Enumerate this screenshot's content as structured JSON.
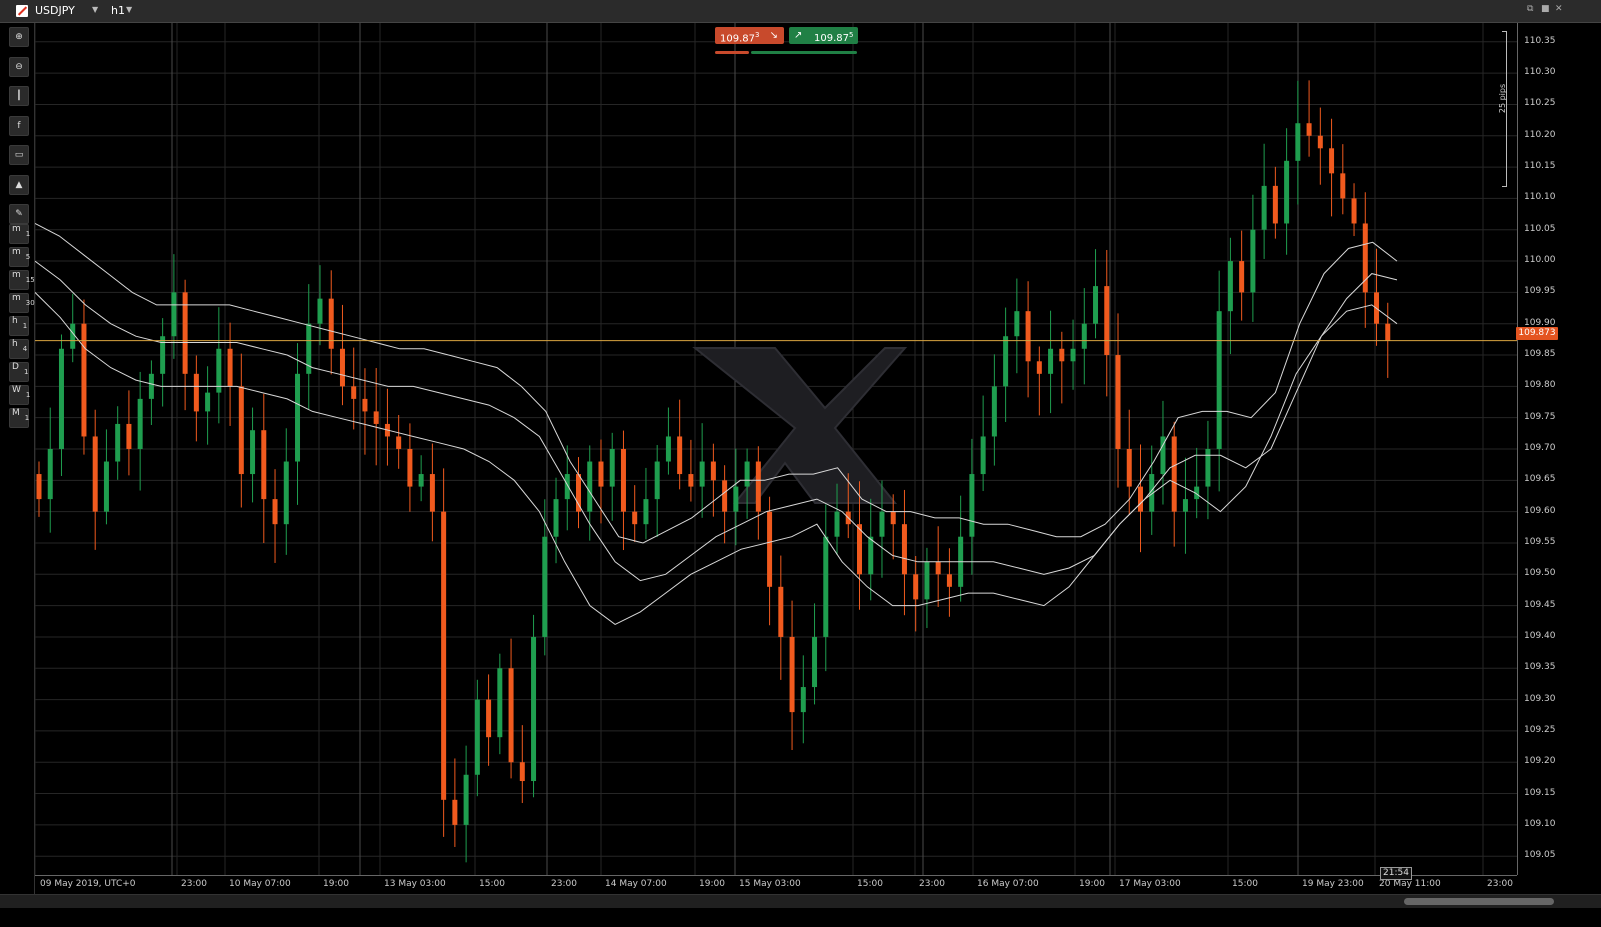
{
  "toolbar": {
    "symbol": "USDJPY",
    "timeframe": "h1"
  },
  "quote": {
    "sell_price": "109.87",
    "sell_sup": "3",
    "buy_price": "109.87",
    "buy_sup": "5",
    "sell_color": "#c84a2c",
    "buy_color": "#208045"
  },
  "sidebar": {
    "icons": [
      "zoom-in-icon",
      "zoom-out-icon",
      "candles-icon",
      "fb-share-icon",
      "link-icon",
      "chart-style-icon",
      "indicators-icon"
    ],
    "timeframes": [
      {
        "main": "m",
        "sub": "1"
      },
      {
        "main": "m",
        "sub": "5"
      },
      {
        "main": "m",
        "sub": "15"
      },
      {
        "main": "m",
        "sub": "30"
      },
      {
        "main": "h",
        "sub": "1"
      },
      {
        "main": "h",
        "sub": "4"
      },
      {
        "main": "D",
        "sub": "1"
      },
      {
        "main": "W",
        "sub": "1"
      },
      {
        "main": "M",
        "sub": "1"
      }
    ]
  },
  "pips_label": "25 pips",
  "current_price": "109.873",
  "current_time": "21:54",
  "colors": {
    "bull": "#1f9e4f",
    "bear": "#f05a1e",
    "price_line": "#d9a441",
    "band": "#d8d8d8"
  },
  "chart_data": {
    "type": "candlestick",
    "symbol": "USDJPY",
    "timeframe": "h1",
    "ylim": [
      109.02,
      110.38
    ],
    "price_ticks": [
      "110.35",
      "110.30",
      "110.25",
      "110.20",
      "110.15",
      "110.10",
      "110.05",
      "110.00",
      "109.95",
      "109.90",
      "109.85",
      "109.80",
      "109.75",
      "109.70",
      "109.65",
      "109.60",
      "109.55",
      "109.50",
      "109.45",
      "109.40",
      "109.35",
      "109.30",
      "109.25",
      "109.20",
      "109.15",
      "109.10",
      "109.05"
    ],
    "time_labels": [
      "09 May 2019, UTC+0",
      "23:00",
      "10 May 07:00",
      "19:00",
      "13 May 03:00",
      "15:00",
      "23:00",
      "14 May 07:00",
      "19:00",
      "15 May 03:00",
      "15:00",
      "23:00",
      "16 May 07:00",
      "19:00",
      "17 May 03:00",
      "15:00",
      "19 May 23:00",
      "20 May 11:00",
      "23:00"
    ],
    "current_price": 109.873,
    "closes": [
      109.62,
      109.7,
      109.86,
      109.9,
      109.72,
      109.6,
      109.68,
      109.74,
      109.7,
      109.78,
      109.82,
      109.88,
      109.95,
      109.82,
      109.76,
      109.79,
      109.86,
      109.8,
      109.66,
      109.73,
      109.62,
      109.58,
      109.68,
      109.82,
      109.9,
      109.94,
      109.86,
      109.8,
      109.78,
      109.76,
      109.74,
      109.72,
      109.7,
      109.64,
      109.66,
      109.6,
      109.14,
      109.1,
      109.18,
      109.3,
      109.24,
      109.35,
      109.2,
      109.17,
      109.4,
      109.56,
      109.62,
      109.66,
      109.6,
      109.68,
      109.64,
      109.7,
      109.6,
      109.58,
      109.62,
      109.68,
      109.72,
      109.66,
      109.64,
      109.68,
      109.65,
      109.6,
      109.64,
      109.68,
      109.6,
      109.48,
      109.4,
      109.28,
      109.32,
      109.4,
      109.56,
      109.6,
      109.58,
      109.5,
      109.56,
      109.6,
      109.58,
      109.5,
      109.46,
      109.52,
      109.5,
      109.48,
      109.56,
      109.66,
      109.72,
      109.8,
      109.88,
      109.92,
      109.84,
      109.82,
      109.86,
      109.84,
      109.86,
      109.9,
      109.96,
      109.85,
      109.7,
      109.64,
      109.6,
      109.66,
      109.72,
      109.6,
      109.62,
      109.64,
      109.7,
      109.92,
      110.0,
      109.95,
      110.05,
      110.12,
      110.06,
      110.16,
      110.22,
      110.2,
      110.18,
      110.14,
      110.1,
      110.06,
      109.95,
      109.9,
      109.873
    ],
    "series": [
      {
        "name": "upper",
        "values": [
          110.06,
          110.04,
          110.01,
          109.98,
          109.95,
          109.93,
          109.93,
          109.93,
          109.93,
          109.92,
          109.91,
          109.9,
          109.89,
          109.88,
          109.87,
          109.86,
          109.86,
          109.85,
          109.84,
          109.83,
          109.8,
          109.76,
          109.68,
          109.62,
          109.56,
          109.55,
          109.57,
          109.59,
          109.62,
          109.65,
          109.65,
          109.66,
          109.66,
          109.67,
          109.62,
          109.6,
          109.6,
          109.59,
          109.59,
          109.58,
          109.58,
          109.57,
          109.56,
          109.56,
          109.58,
          109.62,
          109.68,
          109.75,
          109.76,
          109.76,
          109.75,
          109.79,
          109.9,
          109.98,
          110.02,
          110.03,
          110.0
        ]
      },
      {
        "name": "middle",
        "values": [
          110.0,
          109.97,
          109.93,
          109.9,
          109.88,
          109.87,
          109.87,
          109.87,
          109.87,
          109.86,
          109.85,
          109.83,
          109.82,
          109.81,
          109.8,
          109.8,
          109.79,
          109.78,
          109.77,
          109.75,
          109.72,
          109.65,
          109.58,
          109.52,
          109.49,
          109.5,
          109.53,
          109.56,
          109.58,
          109.6,
          109.61,
          109.62,
          109.6,
          109.56,
          109.53,
          109.52,
          109.52,
          109.52,
          109.52,
          109.51,
          109.5,
          109.51,
          109.53,
          109.58,
          109.62,
          109.67,
          109.69,
          109.69,
          109.67,
          109.7,
          109.79,
          109.88,
          109.94,
          109.98,
          109.97
        ]
      },
      {
        "name": "lower",
        "values": [
          109.95,
          109.91,
          109.86,
          109.83,
          109.81,
          109.8,
          109.8,
          109.8,
          109.8,
          109.79,
          109.78,
          109.76,
          109.75,
          109.74,
          109.73,
          109.72,
          109.71,
          109.7,
          109.68,
          109.65,
          109.6,
          109.52,
          109.45,
          109.42,
          109.44,
          109.47,
          109.5,
          109.52,
          109.54,
          109.55,
          109.56,
          109.58,
          109.52,
          109.48,
          109.45,
          109.45,
          109.46,
          109.47,
          109.47,
          109.46,
          109.45,
          109.48,
          109.53,
          109.58,
          109.62,
          109.65,
          109.63,
          109.6,
          109.64,
          109.72,
          109.82,
          109.88,
          109.92,
          109.93,
          109.9
        ]
      }
    ]
  }
}
